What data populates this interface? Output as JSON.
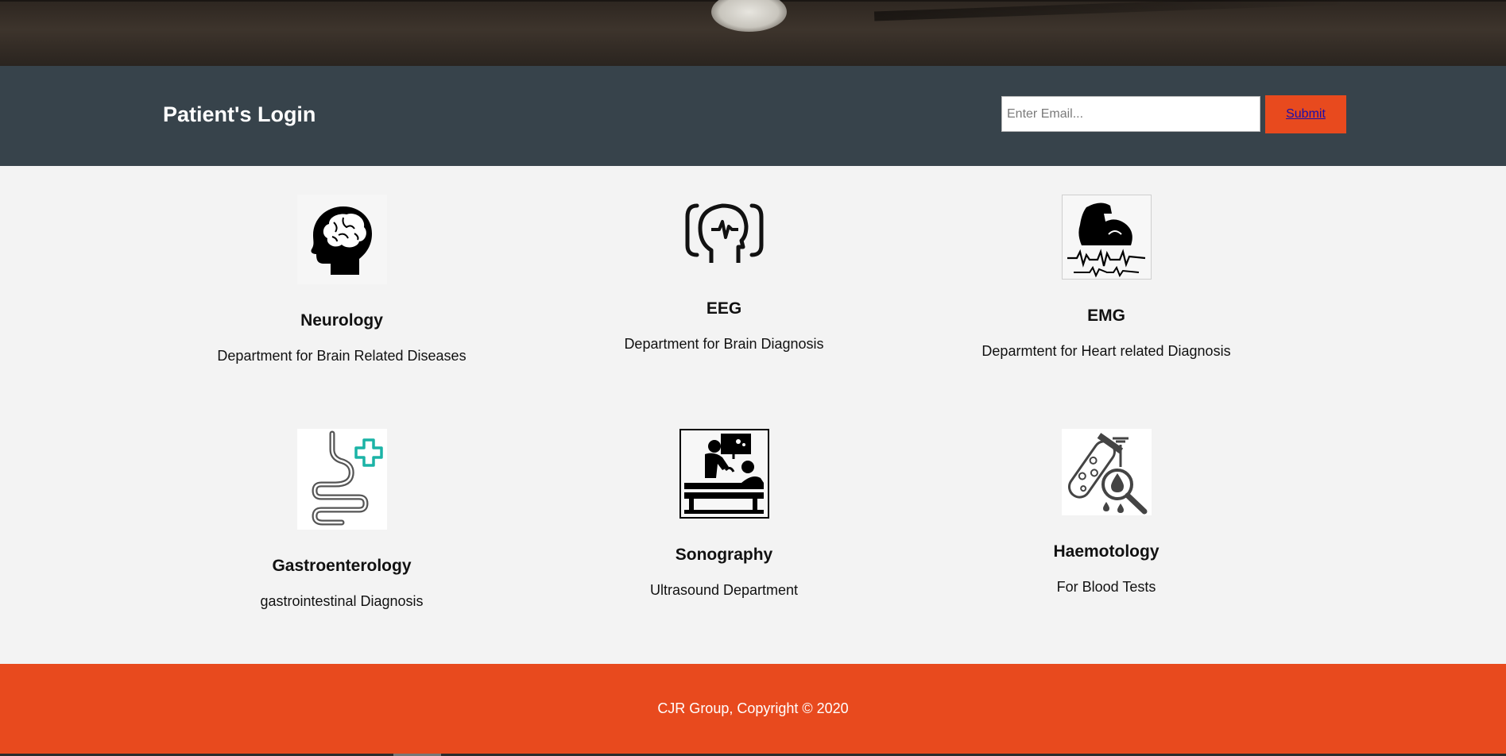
{
  "login": {
    "title": "Patient's Login",
    "email_placeholder": "Enter Email...",
    "submit_label": "Submit"
  },
  "departments": [
    {
      "name": "Neurology",
      "description": "Department for Brain Related Diseases",
      "icon": "brain-head-icon"
    },
    {
      "name": "EEG",
      "description": "Department for Brain Diagnosis",
      "icon": "eeg-head-icon"
    },
    {
      "name": "EMG",
      "description": "Deparmtent for Heart related Diagnosis",
      "icon": "muscle-signal-icon"
    },
    {
      "name": "Gastroenterology",
      "description": "gastrointestinal Diagnosis",
      "icon": "stomach-cross-icon"
    },
    {
      "name": "Sonography",
      "description": "Ultrasound Department",
      "icon": "ultrasound-scan-icon"
    },
    {
      "name": "Haemotology",
      "description": "For Blood Tests",
      "icon": "blood-test-icon"
    }
  ],
  "footer": {
    "text": "CJR Group, Copyright © 2020"
  },
  "colors": {
    "login_bar": "#37434b",
    "accent": "#e84a1e",
    "page_background": "#f3f3f3"
  }
}
